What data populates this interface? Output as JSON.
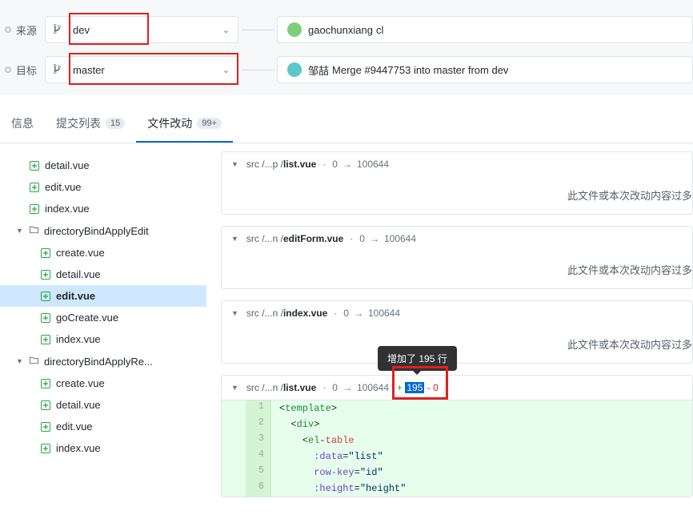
{
  "branch_selector": {
    "source_label": "来源",
    "target_label": "目标",
    "source_branch": "dev",
    "target_branch": "master",
    "source_commit": {
      "author": "gaochunxiang",
      "msg": "cl"
    },
    "target_commit": {
      "author": "邹喆",
      "msg": "Merge #9447753 into master from dev"
    }
  },
  "tabs": {
    "info": "信息",
    "commits": "提交列表",
    "commits_count": "15",
    "changes": "文件改动",
    "changes_count": "99+"
  },
  "sidebar": {
    "items": [
      {
        "name": "detail.vue",
        "type": "file"
      },
      {
        "name": "edit.vue",
        "type": "file"
      },
      {
        "name": "index.vue",
        "type": "file"
      },
      {
        "name": "directoryBindApplyEdit",
        "type": "folder",
        "expanded": true
      },
      {
        "name": "create.vue",
        "type": "file",
        "indent": true
      },
      {
        "name": "detail.vue",
        "type": "file",
        "indent": true
      },
      {
        "name": "edit.vue",
        "type": "file",
        "indent": true,
        "selected": true
      },
      {
        "name": "goCreate.vue",
        "type": "file",
        "indent": true
      },
      {
        "name": "index.vue",
        "type": "file",
        "indent": true
      },
      {
        "name": "directoryBindApplyRe...",
        "type": "folder",
        "expanded": true
      },
      {
        "name": "create.vue",
        "type": "file",
        "indent": true
      },
      {
        "name": "detail.vue",
        "type": "file",
        "indent": true
      },
      {
        "name": "edit.vue",
        "type": "file",
        "indent": true
      },
      {
        "name": "index.vue",
        "type": "file",
        "indent": true
      }
    ]
  },
  "diffs": {
    "file1": {
      "path_prefix": "src /",
      "path_mid": "...p /",
      "path_file": "list.vue",
      "mode_from": "0",
      "mode_to": "100644",
      "message": "此文件或本次改动内容过多"
    },
    "file2": {
      "path_prefix": "src /",
      "path_mid": "...n /",
      "path_file": "editForm.vue",
      "mode_from": "0",
      "mode_to": "100644",
      "message": "此文件或本次改动内容过多"
    },
    "file3": {
      "path_prefix": "src /",
      "path_mid": "...n /",
      "path_file": "index.vue",
      "mode_from": "0",
      "mode_to": "100644",
      "message": "此文件或本次改动内容过多"
    },
    "file4": {
      "path_prefix": "src /",
      "path_mid": "...n /",
      "path_file": "list.vue",
      "mode_from": "0",
      "mode_to": "100644",
      "added": "195",
      "removed": "0",
      "tooltip": "增加了 195 行",
      "lines": [
        {
          "n": "1",
          "html": "<span class='tk-punct'>&lt;</span><span class='tk-tag'>template</span><span class='tk-punct'>&gt;</span>"
        },
        {
          "n": "2",
          "html": "  <span class='tk-punct'>&lt;</span><span class='tk-tag'>div</span><span class='tk-punct'>&gt;</span>"
        },
        {
          "n": "3",
          "html": "    <span class='tk-punct'>&lt;</span><span class='tk-tag'>el</span><span class='tk-punct'>-</span><span class='tk-keyword'>table</span>"
        },
        {
          "n": "4",
          "html": "      <span class='tk-attr'>:data</span><span class='tk-punct'>=</span><span class='tk-str'>\"list\"</span>"
        },
        {
          "n": "5",
          "html": "      <span class='tk-attr'>row-key</span><span class='tk-punct'>=</span><span class='tk-str'>\"id\"</span>"
        },
        {
          "n": "6",
          "html": "      <span class='tk-attr'>:height</span><span class='tk-punct'>=</span><span class='tk-str'>\"height\"</span>"
        }
      ]
    }
  }
}
